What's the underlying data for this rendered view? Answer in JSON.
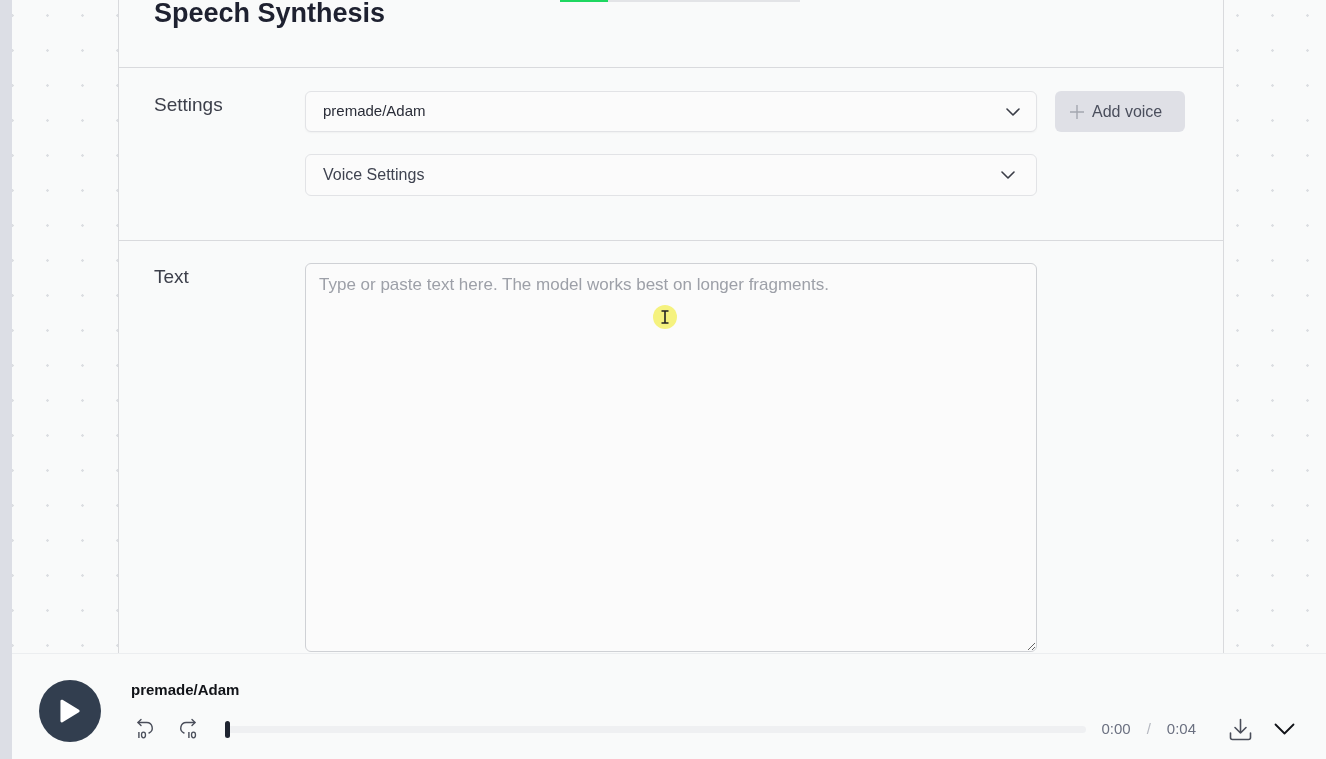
{
  "header": {
    "title": "Speech Synthesis",
    "progress": {
      "level": 0.2
    }
  },
  "settings": {
    "label": "Settings",
    "voice_select": {
      "value": "premade/Adam"
    },
    "add_voice_button": {
      "label": "Add voice"
    },
    "voice_settings": {
      "label": "Voice Settings"
    }
  },
  "text_section": {
    "label": "Text",
    "input": {
      "placeholder": "Type or paste text here. The model works best on longer fragments."
    }
  },
  "player": {
    "track_name": "premade/Adam",
    "level": 0,
    "current_time": "0:00",
    "separator": "/",
    "duration": "0:04"
  }
}
